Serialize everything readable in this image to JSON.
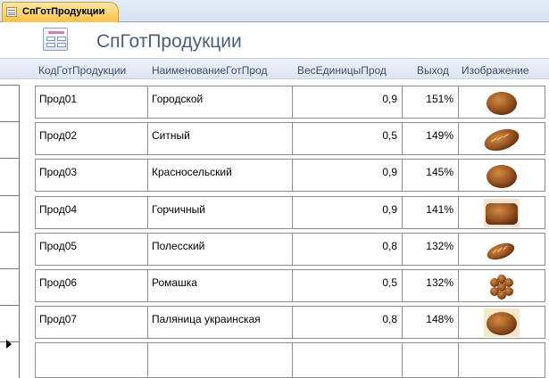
{
  "tab": {
    "label": "СпГотПродукции",
    "icon": "form-icon"
  },
  "header": {
    "title": "СпГотПродукции",
    "icon": "form-icon"
  },
  "columns": {
    "code": "КодГотПродукции",
    "name": "НаименованиеГотПрод",
    "weight": "ВесЕдиницыПрод",
    "yield": "Выход",
    "image": "Изображение"
  },
  "records": [
    {
      "code": "Прод01",
      "name": "Городской",
      "weight": "0,9",
      "yield": "151%",
      "image": "round-loaf-image"
    },
    {
      "code": "Прод02",
      "name": "Ситный",
      "weight": "0,5",
      "yield": "149%",
      "image": "long-loaf-image"
    },
    {
      "code": "Прод03",
      "name": "Красносельский",
      "weight": "0,9",
      "yield": "145%",
      "image": "round-loaf-image"
    },
    {
      "code": "Прод04",
      "name": "Горчичный",
      "weight": "0,9",
      "yield": "141%",
      "image": "brick-loaf-image"
    },
    {
      "code": "Прод05",
      "name": "Полесский",
      "weight": "0,8",
      "yield": "132%",
      "image": "small-loaf-image"
    },
    {
      "code": "Прод06",
      "name": "Ромашка",
      "weight": "0,5",
      "yield": "132%",
      "image": "flower-bun-image"
    },
    {
      "code": "Прод07",
      "name": "Паляница украинская",
      "weight": "0,8",
      "yield": "148%",
      "image": "round-loaf-image"
    },
    {
      "code": "",
      "name": "",
      "weight": "",
      "yield": "",
      "image": ""
    }
  ],
  "colors": {
    "title": "#4a5f7e",
    "tab": "#f8c24a",
    "header_strip": "#dde5f1",
    "bread": "#8b4a1c"
  }
}
